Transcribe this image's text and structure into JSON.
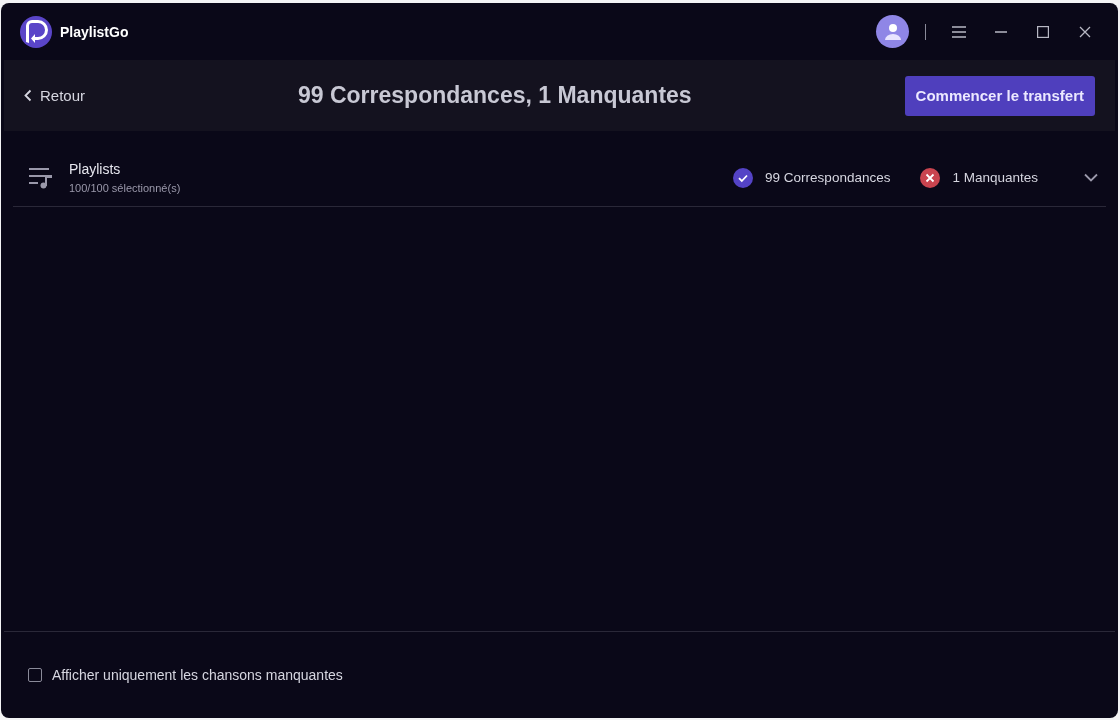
{
  "app": {
    "name": "PlaylistGo"
  },
  "header": {
    "back": "Retour",
    "title": "99 Correspondances, 1 Manquantes",
    "primary_button": "Commencer le transfert"
  },
  "group": {
    "title": "Playlists",
    "subtitle": "100/100 sélectionné(s)",
    "expanded": false,
    "stats": [
      {
        "kind": "matched",
        "label": "99 Correspondances"
      },
      {
        "kind": "missing",
        "label": "1 Manquantes"
      }
    ]
  },
  "footer": {
    "checkbox": {
      "label": "Afficher uniquement les chansons manquantes",
      "checked": false
    }
  }
}
